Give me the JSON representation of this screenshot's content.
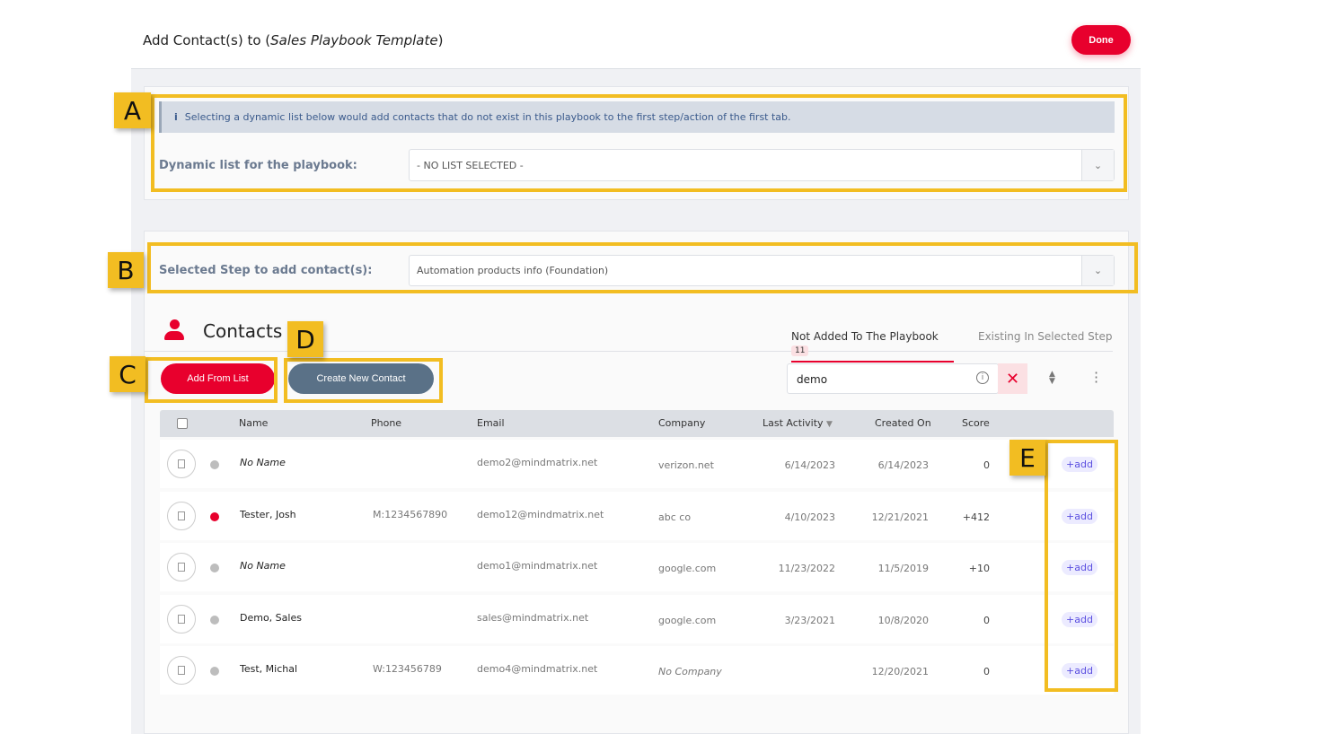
{
  "header": {
    "title_prefix": "Add Contact(s) to (",
    "title_name": "Sales Playbook Template",
    "title_suffix": ")",
    "done_label": "Done"
  },
  "dynamic": {
    "info": "Selecting a dynamic list below would add contacts that do not exist in this playbook to the first step/action of the first tab.",
    "label": "Dynamic list for the playbook:",
    "value": "- NO LIST SELECTED -"
  },
  "step": {
    "label": "Selected Step to add contact(s):",
    "value": "Automation products info (Foundation)"
  },
  "contacts": {
    "title": "Contacts",
    "tabs": [
      {
        "label": "Not Added To The Playbook",
        "count": "11"
      },
      {
        "label": "Existing In Selected Step"
      }
    ],
    "add_from_list": "Add From List",
    "create_new": "Create New Contact",
    "search_value": "demo"
  },
  "table": {
    "headers": [
      "Name",
      "Phone",
      "Email",
      "Company",
      "Last Activity",
      "Created On",
      "Score"
    ],
    "rows": [
      {
        "name": "No Name",
        "phone": "",
        "email": "demo2@mindmatrix.net",
        "company": "verizon.net",
        "last": "6/14/2023",
        "created": "6/14/2023",
        "score": "0",
        "status": "#bdbdbd",
        "add": "add"
      },
      {
        "name": "Tester, Josh",
        "phone": "M:1234567890",
        "email": "demo12@mindmatrix.net",
        "company": "abc co",
        "last": "4/10/2023",
        "created": "12/21/2021",
        "score": "+412",
        "status": "#e8002d",
        "add": "add"
      },
      {
        "name": "No Name",
        "phone": "",
        "email": "demo1@mindmatrix.net",
        "company": "google.com",
        "last": "11/23/2022",
        "created": "11/5/2019",
        "score": "+10",
        "status": "#bdbdbd",
        "add": "add"
      },
      {
        "name": "Demo, Sales",
        "phone": "",
        "email": "sales@mindmatrix.net",
        "company": "google.com",
        "last": "3/23/2021",
        "created": "10/8/2020",
        "score": "0",
        "status": "#bdbdbd",
        "add": "add"
      },
      {
        "name": "Test, Michal",
        "phone": "W:123456789",
        "email": "demo4@mindmatrix.net",
        "company": "No Company",
        "last": "",
        "created": "12/20/2021",
        "score": "0",
        "status": "#bdbdbd",
        "add": "add"
      }
    ]
  },
  "annotations": [
    "A",
    "B",
    "C",
    "D",
    "E"
  ],
  "colors": {
    "accent": "#e8002d",
    "secondary": "#5a7187",
    "highlight": "#f2bd22"
  }
}
